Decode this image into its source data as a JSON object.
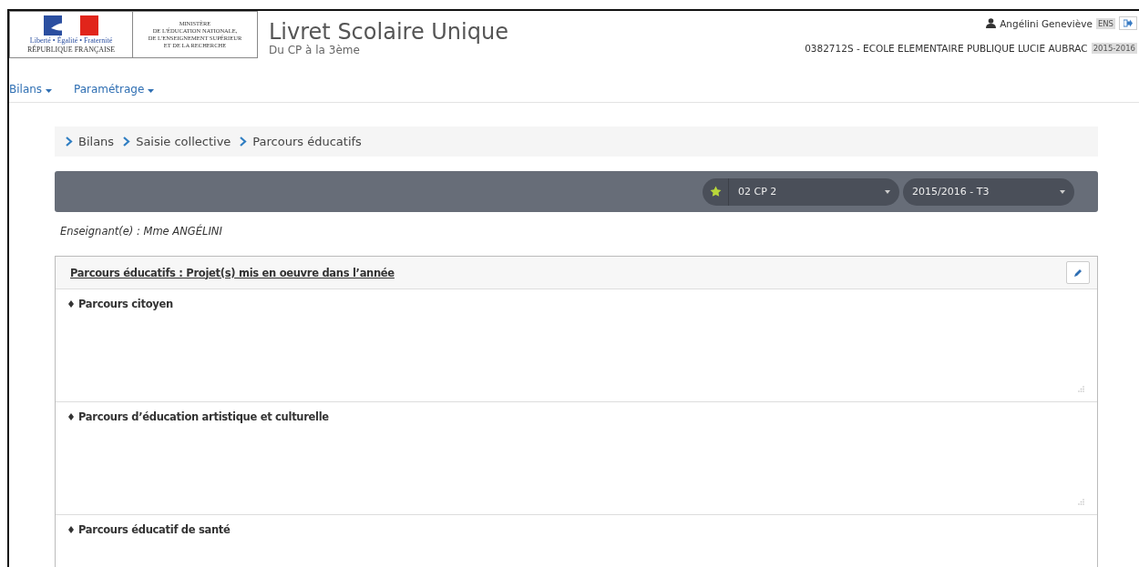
{
  "header": {
    "logo": {
      "motto": "Liberté • Égalité • Fraternité",
      "republic": "RÉPUBLIQUE FRANÇAISE"
    },
    "ministry": [
      "MINISTÈRE",
      "DE L'ÉDUCATION NATIONALE,",
      "DE L'ENSEIGNEMENT SUPÉRIEUR",
      "ET DE LA RECHERCHE"
    ],
    "title": "Livret Scolaire Unique",
    "subtitle": "Du CP à la 3ème",
    "user": {
      "name": "Angélini Geneviève",
      "role": "ENS"
    },
    "school": "0382712S - ECOLE ELEMENTAIRE PUBLIQUE LUCIE AUBRAC",
    "year": "2015-2016"
  },
  "nav": [
    {
      "label": "Bilans"
    },
    {
      "label": "Paramétrage"
    }
  ],
  "breadcrumb": [
    "Bilans",
    "Saisie collective",
    "Parcours éducatifs"
  ],
  "filters": {
    "favorite": true,
    "class": "02 CP 2",
    "period": "2015/2016 - T3"
  },
  "teacher": "Enseignant(e) : Mme ANGÉLINI",
  "panel": {
    "title": "Parcours éducatifs : Projet(s) mis en oeuvre dans l’année",
    "sections": [
      {
        "label": "Parcours citoyen",
        "kind": "textarea"
      },
      {
        "label": "Parcours d’éducation artistique et culturelle",
        "kind": "textarea"
      },
      {
        "label": "Parcours éducatif de santé",
        "kind": "textarea"
      }
    ]
  }
}
